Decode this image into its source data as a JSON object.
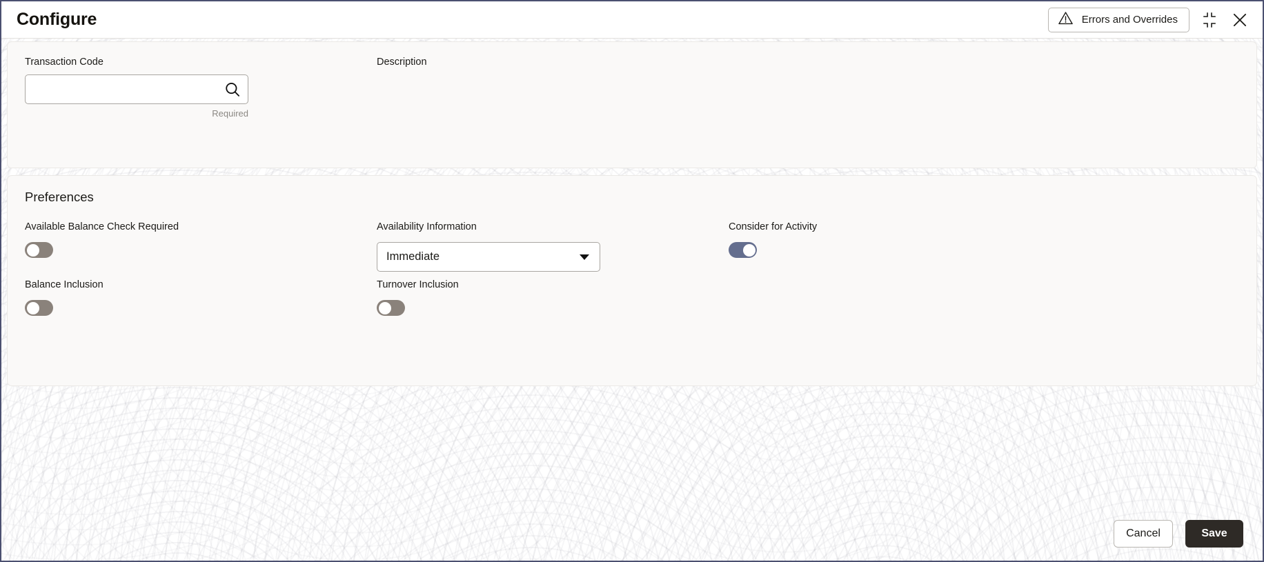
{
  "window": {
    "title": "Configure",
    "errors_button_label": "Errors and Overrides",
    "errors_icon": "warning-triangle-icon",
    "minimize_icon": "collapse-corners-icon",
    "close_icon": "close-x-icon",
    "border_color": "#4b5070"
  },
  "transaction_section": {
    "transaction_code": {
      "label": "Transaction Code",
      "value": "",
      "placeholder": "",
      "helper_text": "Required",
      "search_icon": "search-icon"
    },
    "description": {
      "label": "Description",
      "value": ""
    }
  },
  "preferences_section": {
    "title": "Preferences",
    "rows": [
      {
        "available_balance_check": {
          "label": "Available Balance Check Required",
          "type": "toggle",
          "state": "off",
          "color": "#8a827b"
        },
        "availability_information": {
          "label": "Availability Information",
          "type": "select",
          "value": "Immediate",
          "options": [
            "Immediate"
          ],
          "caret_icon": "chevron-down-icon"
        },
        "consider_for_activity": {
          "label": "Consider for Activity",
          "type": "toggle",
          "state": "on",
          "color": "#646e8e"
        }
      },
      {
        "balance_inclusion": {
          "label": "Balance Inclusion",
          "type": "toggle",
          "state": "off",
          "color": "#8a827b"
        },
        "turnover_inclusion": {
          "label": "Turnover Inclusion",
          "type": "toggle",
          "state": "off",
          "color": "#8a827b"
        }
      }
    ]
  },
  "footer": {
    "cancel_label": "Cancel",
    "save_label": "Save"
  }
}
